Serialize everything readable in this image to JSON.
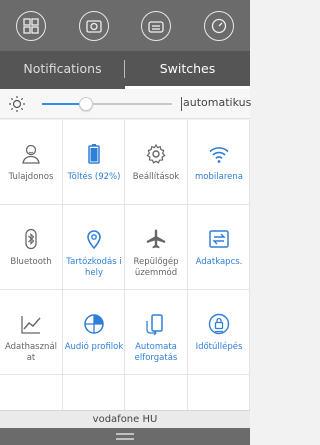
{
  "top_icons": [
    "apps-grid-icon",
    "camera-icon",
    "radio-icon",
    "clock-icon"
  ],
  "tabs": [
    {
      "label": "Notifications",
      "active": false
    },
    {
      "label": "Switches",
      "active": true
    }
  ],
  "brightness": {
    "level": 0.34,
    "auto_label": "automatikus"
  },
  "toggles": [
    {
      "label": "Tulajdonos",
      "icon": "person-icon",
      "on": false
    },
    {
      "label": "Töltés (92%)",
      "icon": "battery-icon",
      "on": true
    },
    {
      "label": "Beállítások",
      "icon": "gear-icon",
      "on": false
    },
    {
      "label": "mobilarena",
      "icon": "wifi-icon",
      "on": true
    },
    {
      "label": "Bluetooth",
      "icon": "bluetooth-icon",
      "on": false
    },
    {
      "label": "Tartózkodás i hely",
      "icon": "location-icon",
      "on": true
    },
    {
      "label": "Repülőgép üzemmód",
      "icon": "airplane-icon",
      "on": false
    },
    {
      "label": "Adatkapcs.",
      "icon": "data-transfer-icon",
      "on": true
    },
    {
      "label": "Adathasznál at",
      "icon": "data-usage-icon",
      "on": false
    },
    {
      "label": "Audió profilok",
      "icon": "audio-profile-icon",
      "on": true
    },
    {
      "label": "Automata elforgatás",
      "icon": "rotation-icon",
      "on": true
    },
    {
      "label": "Időtúllépés",
      "icon": "timeout-icon",
      "on": true
    }
  ],
  "colors": {
    "accent": "#2f7fd8",
    "inactive": "#666666",
    "topbar": "#6b6b6b",
    "tabbar": "#555555"
  },
  "carrier": "vodafone HU"
}
